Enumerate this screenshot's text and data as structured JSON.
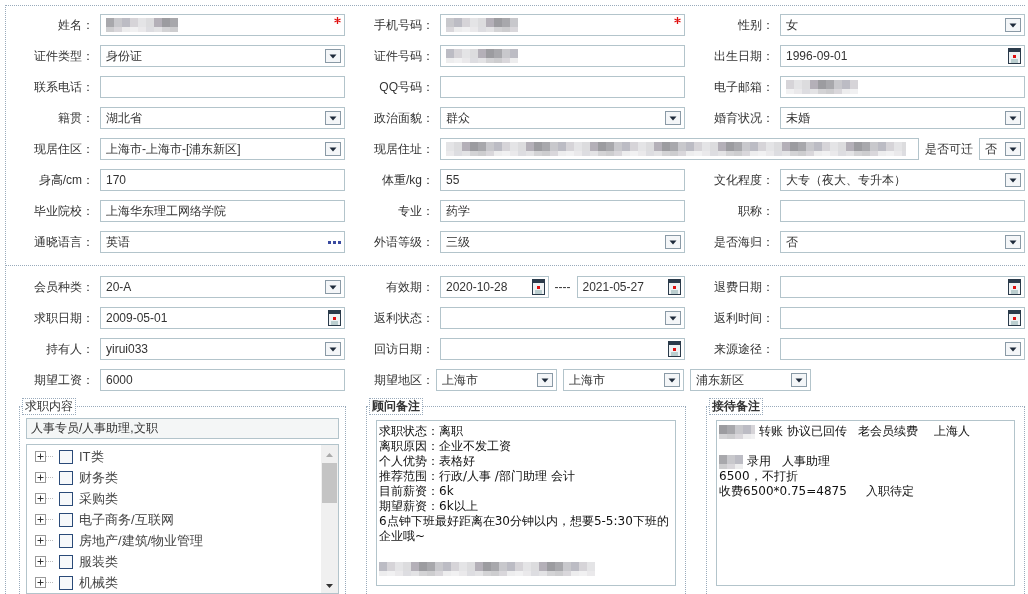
{
  "profile_rows": [
    {
      "kind": "standard",
      "cells": [
        {
          "label": "姓名：",
          "fields": [
            {
              "kind": "text",
              "redacted": true,
              "required": true
            }
          ]
        },
        {
          "label": "手机号码：",
          "fields": [
            {
              "kind": "text",
              "redacted": true,
              "required": true
            }
          ]
        },
        {
          "label": "性别：",
          "fields": [
            {
              "kind": "select",
              "value": "女"
            }
          ]
        }
      ]
    },
    {
      "kind": "standard",
      "cells": [
        {
          "label": "证件类型：",
          "fields": [
            {
              "kind": "select",
              "value": "身份证"
            }
          ]
        },
        {
          "label": "证件号码：",
          "fields": [
            {
              "kind": "text",
              "redacted": true
            }
          ]
        },
        {
          "label": "出生日期：",
          "fields": [
            {
              "kind": "date",
              "value": "1996-09-01"
            }
          ]
        }
      ]
    },
    {
      "kind": "standard",
      "cells": [
        {
          "label": "联系电话：",
          "fields": [
            {
              "kind": "text"
            }
          ]
        },
        {
          "label": "QQ号码：",
          "fields": [
            {
              "kind": "text"
            }
          ]
        },
        {
          "label": "电子邮箱：",
          "fields": [
            {
              "kind": "text",
              "redacted": true
            }
          ]
        }
      ]
    },
    {
      "kind": "standard",
      "cells": [
        {
          "label": "籍贯：",
          "fields": [
            {
              "kind": "select",
              "value": "湖北省"
            }
          ]
        },
        {
          "label": "政治面貌：",
          "fields": [
            {
              "kind": "select",
              "value": "群众"
            }
          ]
        },
        {
          "label": "婚育状况：",
          "fields": [
            {
              "kind": "select",
              "value": "未婚"
            }
          ]
        }
      ]
    },
    {
      "kind": "address",
      "cells": [
        {
          "label": "现居住区：",
          "fields": [
            {
              "kind": "select",
              "value": "上海市-上海市-[浦东新区]"
            }
          ]
        },
        {
          "label": "现居住址：",
          "fields": [
            {
              "kind": "text",
              "redacted": true
            }
          ]
        },
        {
          "label": "是否可迁",
          "fields": [
            {
              "kind": "select",
              "value": "否"
            }
          ]
        }
      ]
    },
    {
      "kind": "standard",
      "cells": [
        {
          "label": "身高/cm：",
          "fields": [
            {
              "kind": "text",
              "value": "170"
            }
          ]
        },
        {
          "label": "体重/kg：",
          "fields": [
            {
              "kind": "text",
              "value": "55"
            }
          ]
        },
        {
          "label": "文化程度：",
          "fields": [
            {
              "kind": "select",
              "value": "大专（夜大、专升本）"
            }
          ]
        }
      ]
    },
    {
      "kind": "standard",
      "cells": [
        {
          "label": "毕业院校：",
          "fields": [
            {
              "kind": "text",
              "value": "上海华东理工网络学院"
            }
          ]
        },
        {
          "label": "专业：",
          "fields": [
            {
              "kind": "text",
              "value": "药学"
            }
          ]
        },
        {
          "label": "职称：",
          "fields": [
            {
              "kind": "text"
            }
          ]
        }
      ]
    },
    {
      "kind": "standard",
      "cells": [
        {
          "label": "通晓语言：",
          "fields": [
            {
              "kind": "picker",
              "value": "英语"
            }
          ]
        },
        {
          "label": "外语等级：",
          "fields": [
            {
              "kind": "select",
              "value": "三级"
            }
          ]
        },
        {
          "label": "是否海归：",
          "fields": [
            {
              "kind": "select",
              "value": "否"
            }
          ]
        }
      ]
    }
  ],
  "member_rows": [
    {
      "kind": "standard",
      "cells": [
        {
          "label": "会员种类：",
          "fields": [
            {
              "kind": "select",
              "value": "20-A"
            }
          ]
        },
        {
          "label": "有效期：",
          "separator": "----",
          "fields": [
            {
              "kind": "date",
              "value": "2020-10-28"
            },
            {
              "kind": "date",
              "value": "2021-05-27"
            }
          ]
        },
        {
          "label": "退费日期：",
          "fields": [
            {
              "kind": "date"
            }
          ]
        }
      ]
    },
    {
      "kind": "standard",
      "cells": [
        {
          "label": "求职日期：",
          "fields": [
            {
              "kind": "date",
              "value": "2009-05-01"
            }
          ]
        },
        {
          "label": "返利状态：",
          "fields": [
            {
              "kind": "select"
            }
          ]
        },
        {
          "label": "返利时间：",
          "fields": [
            {
              "kind": "date"
            }
          ]
        }
      ]
    },
    {
      "kind": "standard",
      "cells": [
        {
          "label": "持有人：",
          "fields": [
            {
              "kind": "select",
              "value": "yirui033"
            }
          ]
        },
        {
          "label": "回访日期：",
          "fields": [
            {
              "kind": "date"
            }
          ]
        },
        {
          "label": "来源途径：",
          "fields": [
            {
              "kind": "select"
            }
          ]
        }
      ]
    },
    {
      "kind": "standard",
      "cells": [
        {
          "label": "期望工资：",
          "fields": [
            {
              "kind": "text",
              "value": "6000"
            }
          ]
        },
        {
          "label": "期望地区：",
          "fields": [
            {
              "kind": "select",
              "value": "上海市"
            },
            {
              "kind": "select",
              "value": "上海市"
            },
            {
              "kind": "select",
              "value": "浦东新区"
            }
          ]
        }
      ]
    }
  ],
  "job_panel": {
    "legend": "求职内容",
    "value": "人事专员/人事助理,文职",
    "tree": [
      {
        "label": "IT类",
        "expanded": false,
        "checked": false
      },
      {
        "label": "财务类",
        "expanded": false,
        "checked": false
      },
      {
        "label": "采购类",
        "expanded": false,
        "checked": false
      },
      {
        "label": "电子商务/互联网",
        "expanded": false,
        "checked": false
      },
      {
        "label": "房地产/建筑/物业管理",
        "expanded": false,
        "checked": false
      },
      {
        "label": "服装类",
        "expanded": false,
        "checked": false
      },
      {
        "label": "机械类",
        "expanded": false,
        "checked": false
      }
    ]
  },
  "note_panels": [
    {
      "legend": "顾问备注",
      "lines": [
        {
          "text": "求职状态：离职"
        },
        {
          "text": "离职原因：企业不发工资"
        },
        {
          "text": "个人优势：表格好"
        },
        {
          "text": "推荐范围：行政/人事 /部门助理 会计"
        },
        {
          "text": "目前薪资：6k"
        },
        {
          "text": "期望薪资：6k以上"
        },
        {
          "text": "6点钟下班最好距离在30分钟以内，想要5-5:30下班的企业哦~"
        },
        {
          "redacted": true
        }
      ]
    },
    {
      "legend": "接待备注",
      "lines": [
        {
          "text": "转账 协议已回传   老会员续费    上海人",
          "redacted": true
        },
        {
          "text": "录用   人事助理",
          "redacted": true
        },
        {
          "text": "6500，不打折"
        },
        {
          "text": "收费6500*0.75=4875     入职待定"
        }
      ]
    }
  ]
}
